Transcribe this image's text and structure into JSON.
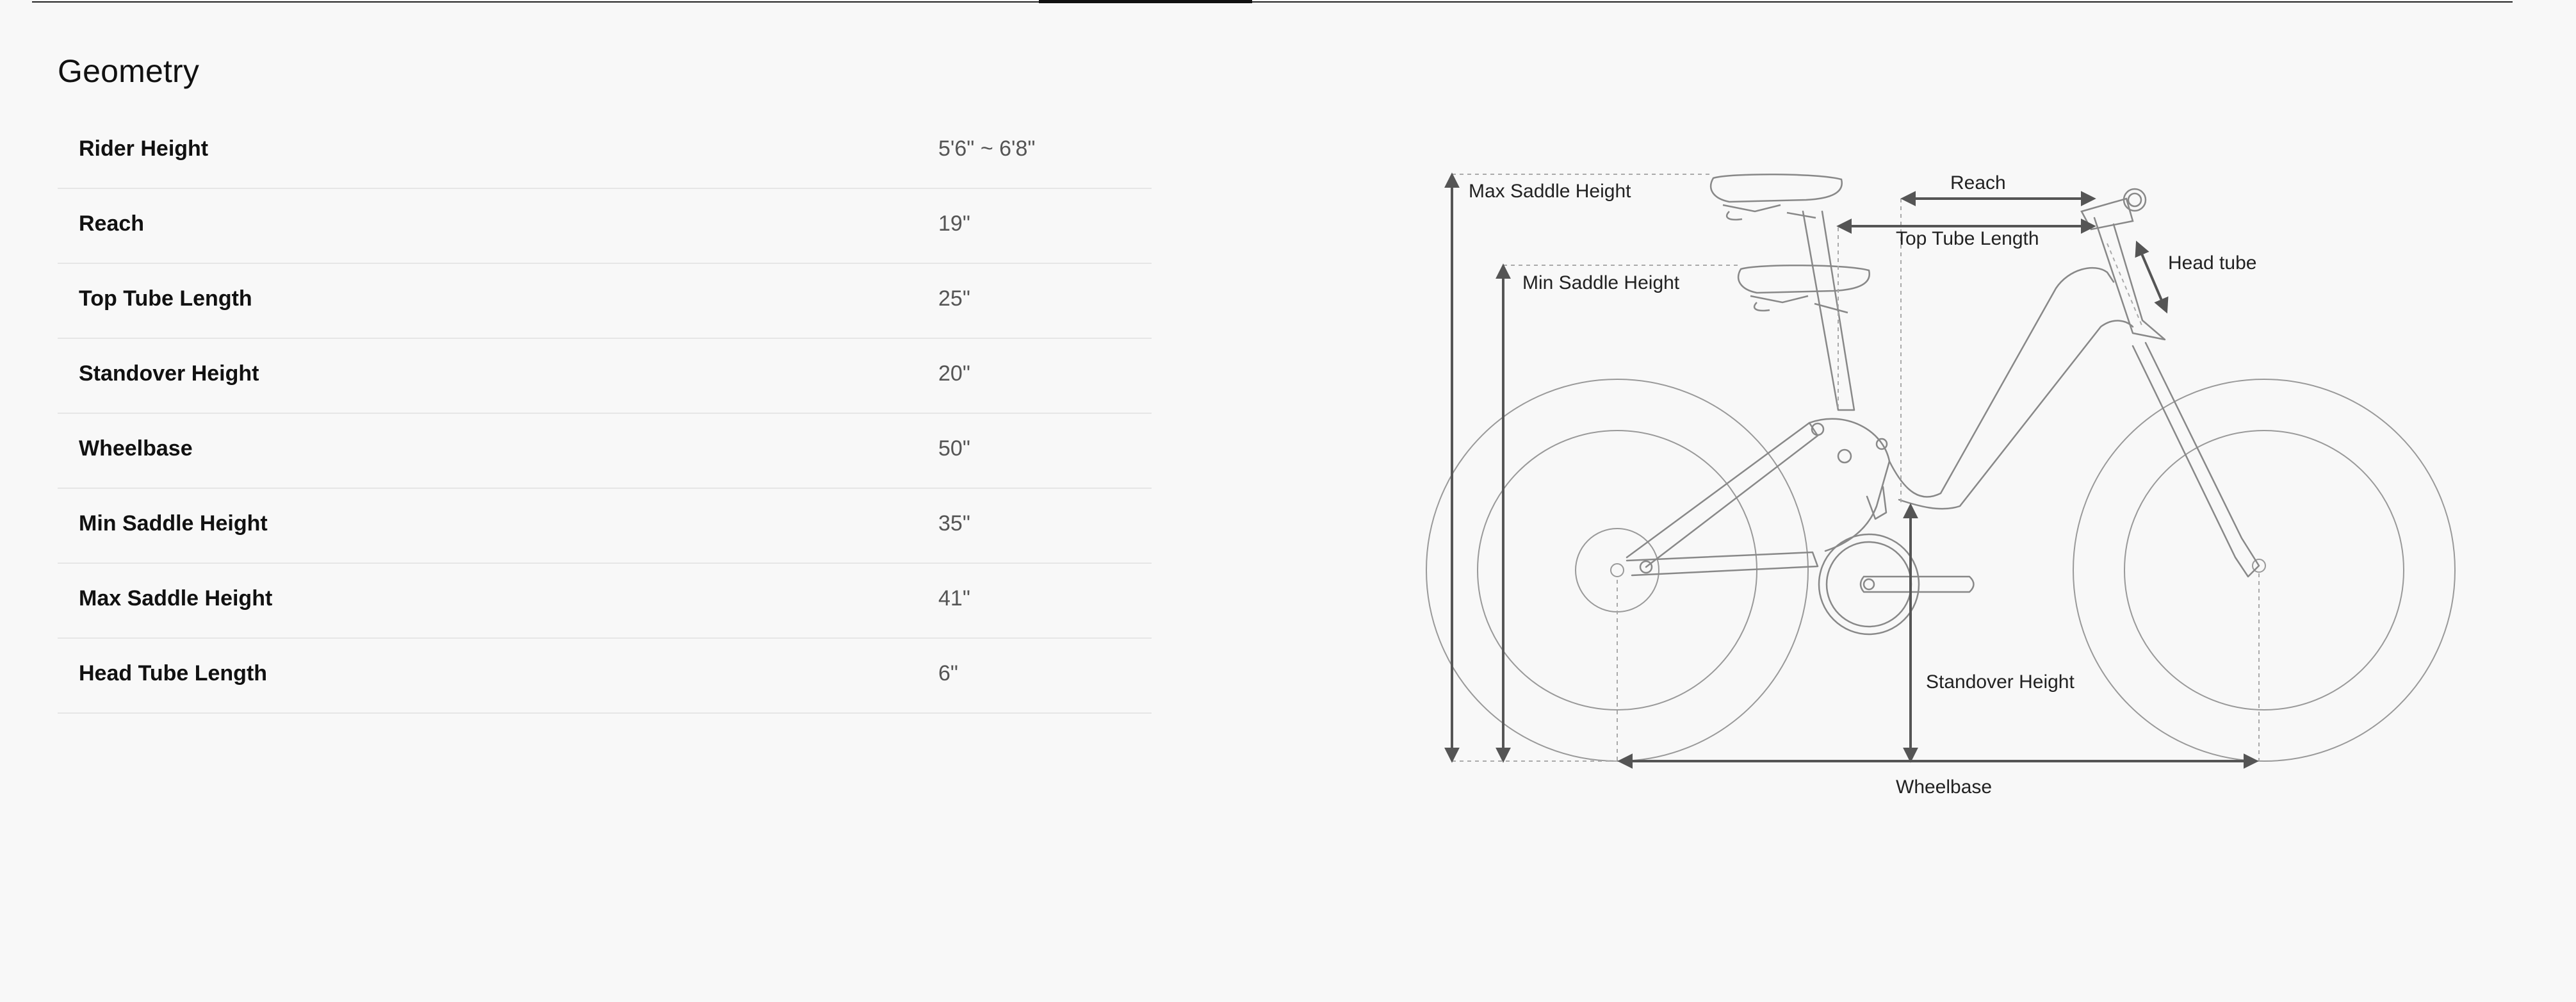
{
  "section": {
    "title": "Geometry"
  },
  "geometry": {
    "rows": [
      {
        "label": "Rider Height",
        "value": "5'6\" ~ 6'8\""
      },
      {
        "label": "Reach",
        "value": "19\""
      },
      {
        "label": "Top Tube Length",
        "value": "25\""
      },
      {
        "label": "Standover Height",
        "value": "20\""
      },
      {
        "label": "Wheelbase",
        "value": "50\""
      },
      {
        "label": "Min Saddle Height",
        "value": "35\""
      },
      {
        "label": "Max Saddle Height",
        "value": "41\""
      },
      {
        "label": "Head Tube Length",
        "value": "6\""
      }
    ]
  },
  "diagram": {
    "labels": {
      "max_saddle_height": "Max Saddle Height",
      "min_saddle_height": "Min Saddle Height",
      "reach": "Reach",
      "top_tube_length": "Top Tube Length",
      "head_tube": "Head tube",
      "standover_height": "Standover Height",
      "wheelbase": "Wheelbase"
    }
  }
}
